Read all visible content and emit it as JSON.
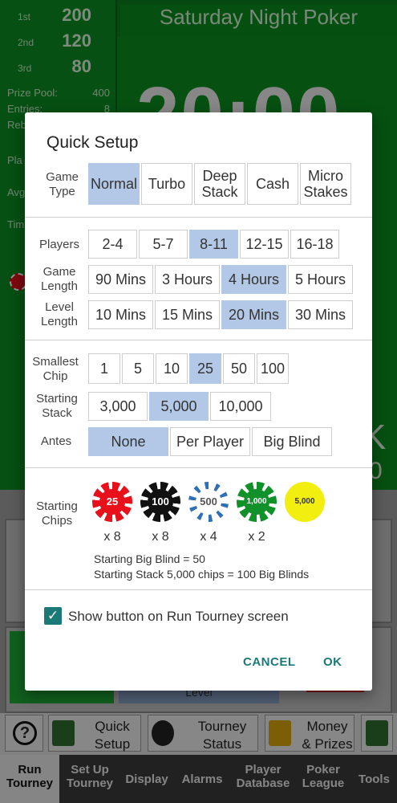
{
  "background": {
    "title": "Saturday Night Poker",
    "places": [
      {
        "label": "1st",
        "value": "200"
      },
      {
        "label": "2nd",
        "value": "120"
      },
      {
        "label": "3rd",
        "value": "80"
      }
    ],
    "prize_pool_label": "Prize Pool:",
    "prize_pool_value": "400",
    "entries_label": "Entries:",
    "entries_value": "8",
    "rebuys_label": "Reb",
    "players_label": "Pla",
    "average_label": "Avg",
    "time_label": "Tim",
    "timer": "20:00",
    "big_k": "K",
    "big_o": "0",
    "level_label": "Level"
  },
  "toolbar": {
    "help": "?",
    "quick_setup": [
      "Quick",
      "Setup"
    ],
    "tourney_status": [
      "Tourney",
      "Status"
    ],
    "money_prizes": [
      "Money",
      "& Prizes"
    ]
  },
  "nav": {
    "items": [
      {
        "l1": "Run",
        "l2": "Tourney",
        "active": true
      },
      {
        "l1": "Set Up",
        "l2": "Tourney"
      },
      {
        "l1": "Display",
        "l2": ""
      },
      {
        "l1": "Alarms",
        "l2": ""
      },
      {
        "l1": "Player",
        "l2": "Database"
      },
      {
        "l1": "Poker",
        "l2": "League"
      },
      {
        "l1": "Tools",
        "l2": ""
      }
    ]
  },
  "dialog": {
    "title": "Quick Setup",
    "game_type": {
      "label": [
        "Game",
        "Type"
      ],
      "options": [
        {
          "label": [
            "Normal"
          ],
          "selected": true
        },
        {
          "label": [
            "Turbo"
          ]
        },
        {
          "label": [
            "Deep",
            "Stack"
          ]
        },
        {
          "label": [
            "Cash"
          ]
        },
        {
          "label": [
            "Micro",
            "Stakes"
          ]
        }
      ]
    },
    "players": {
      "label": [
        "Players"
      ],
      "options": [
        "2-4",
        "5-7",
        "8-11",
        "12-15",
        "16-18"
      ],
      "selected": 2
    },
    "game_length": {
      "label": [
        "Game",
        "Length"
      ],
      "options": [
        "90 Mins",
        "3 Hours",
        "4 Hours",
        "5 Hours"
      ],
      "selected": 2
    },
    "level_length": {
      "label": [
        "Level",
        "Length"
      ],
      "options": [
        "10 Mins",
        "15 Mins",
        "20 Mins",
        "30 Mins"
      ],
      "selected": 2
    },
    "smallest_chip": {
      "label": [
        "Smallest",
        "Chip"
      ],
      "options": [
        "1",
        "5",
        "10",
        "25",
        "50",
        "100"
      ],
      "selected": 3
    },
    "starting_stack": {
      "label": [
        "Starting",
        "Stack"
      ],
      "options": [
        "3,000",
        "5,000",
        "10,000"
      ],
      "selected": 1
    },
    "antes": {
      "label": [
        "Antes"
      ],
      "options": [
        "None",
        "Per Player",
        "Big Blind"
      ],
      "selected": 0
    },
    "starting_chips": {
      "label": [
        "Starting",
        "Chips"
      ],
      "chips": [
        {
          "value": "25",
          "count": "x 8",
          "color": "#e8101a",
          "text_color": "#ffffff",
          "stripe": "#ffffff"
        },
        {
          "value": "100",
          "count": "x 8",
          "color": "#111111",
          "text_color": "#ffffff",
          "stripe": "#ffffff"
        },
        {
          "value": "500",
          "count": "x 4",
          "color": "#ffffff",
          "text_color": "#555555",
          "stripe": "#2f6fb5"
        },
        {
          "value": "1,000",
          "count": "x 2",
          "color": "#11912a",
          "text_color": "#ffffff",
          "stripe": "#ffffff"
        },
        {
          "value": "5,000",
          "count": "",
          "color": "#f2ee10",
          "text_color": "#333333",
          "stripe": "#f2ee10"
        }
      ]
    },
    "info_big_blind": "Starting Big Blind = 50",
    "info_stack": "Starting Stack 5,000 chips = 100 Big Blinds",
    "show_button_label": "Show button on Run Tourney screen",
    "show_button_checked": true,
    "cancel": "CANCEL",
    "ok": "OK"
  }
}
